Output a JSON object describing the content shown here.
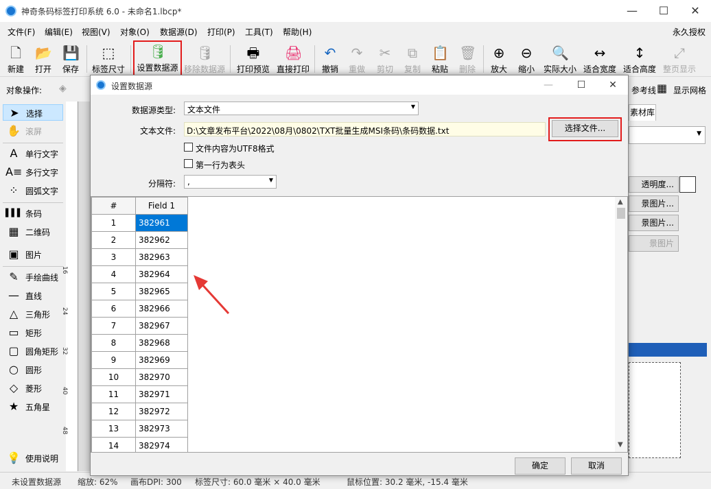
{
  "window": {
    "title": "神奇条码标签打印系统 6.0 - 未命名1.lbcp*",
    "min": "—",
    "max": "☐",
    "close": "✕"
  },
  "menu": {
    "items": [
      "文件(F)",
      "编辑(E)",
      "视图(V)",
      "对象(O)",
      "数据源(D)",
      "打印(P)",
      "工具(T)",
      "帮助(H)"
    ],
    "license": "永久授权"
  },
  "toolbar": [
    {
      "label": "新建",
      "icon": "new-file-icon",
      "glyph": "🗋"
    },
    {
      "label": "打开",
      "icon": "open-icon",
      "glyph": "📂"
    },
    {
      "label": "保存",
      "icon": "save-icon",
      "glyph": "💾"
    },
    {
      "label": "标签尺寸",
      "icon": "label-size-icon",
      "glyph": "⬚"
    },
    {
      "label": "设置数据源",
      "icon": "database-icon",
      "glyph": "🛢"
    },
    {
      "label": "移除数据源",
      "icon": "database-remove-icon",
      "glyph": "🛢"
    },
    {
      "label": "打印预览",
      "icon": "print-preview-icon",
      "glyph": "🖶"
    },
    {
      "label": "直接打印",
      "icon": "printer-icon",
      "glyph": "🖨"
    },
    {
      "label": "撤销",
      "icon": "undo-icon",
      "glyph": "↶"
    },
    {
      "label": "重做",
      "icon": "redo-icon",
      "glyph": "↷"
    },
    {
      "label": "剪切",
      "icon": "cut-icon",
      "glyph": "✂"
    },
    {
      "label": "复制",
      "icon": "copy-icon",
      "glyph": "⧉"
    },
    {
      "label": "粘贴",
      "icon": "paste-icon",
      "glyph": "📋"
    },
    {
      "label": "删除",
      "icon": "delete-icon",
      "glyph": "🗑"
    },
    {
      "label": "放大",
      "icon": "zoom-in-icon",
      "glyph": "⊕"
    },
    {
      "label": "缩小",
      "icon": "zoom-out-icon",
      "glyph": "⊖"
    },
    {
      "label": "实际大小",
      "icon": "actual-size-icon",
      "glyph": "🔍"
    },
    {
      "label": "适合宽度",
      "icon": "fit-width-icon",
      "glyph": "↔"
    },
    {
      "label": "适合高度",
      "icon": "fit-height-icon",
      "glyph": "↕"
    },
    {
      "label": "整页显示",
      "icon": "fit-page-icon",
      "glyph": "⤢"
    }
  ],
  "object_row": {
    "label": "对象操作:",
    "ref_line": "参考线",
    "show_grid": "显示网格"
  },
  "tools": [
    {
      "label": "选择",
      "icon": "pointer-icon",
      "glyph": "➤"
    },
    {
      "label": "滚屏",
      "icon": "hand-icon",
      "glyph": "✋"
    },
    {
      "label": "单行文字",
      "icon": "single-line-text-icon",
      "glyph": "A"
    },
    {
      "label": "多行文字",
      "icon": "multi-line-text-icon",
      "glyph": "A≡"
    },
    {
      "label": "圆弧文字",
      "icon": "arc-text-icon",
      "glyph": "⁘"
    },
    {
      "label": "条码",
      "icon": "barcode-icon",
      "glyph": "▌▌▌"
    },
    {
      "label": "二维码",
      "icon": "qrcode-icon",
      "glyph": "▦"
    },
    {
      "label": "图片",
      "icon": "image-icon",
      "glyph": "▣"
    },
    {
      "label": "手绘曲线",
      "icon": "pen-icon",
      "glyph": "✎"
    },
    {
      "label": "直线",
      "icon": "line-icon",
      "glyph": "—"
    },
    {
      "label": "三角形",
      "icon": "triangle-icon",
      "glyph": "△"
    },
    {
      "label": "矩形",
      "icon": "rectangle-icon",
      "glyph": "▭"
    },
    {
      "label": "圆角矩形",
      "icon": "rounded-rect-icon",
      "glyph": "▢"
    },
    {
      "label": "圆形",
      "icon": "circle-icon",
      "glyph": "○"
    },
    {
      "label": "菱形",
      "icon": "diamond-icon",
      "glyph": "◇"
    },
    {
      "label": "五角星",
      "icon": "star-icon",
      "glyph": "★"
    },
    {
      "label": "使用说明",
      "icon": "bulb-icon",
      "glyph": "💡"
    }
  ],
  "ruler_ticks": [
    "16",
    "24",
    "32",
    "40",
    "48"
  ],
  "right_panel": {
    "tab": "素材库",
    "b1": "透明度...",
    "b2": "景图片...",
    "b3": "景图片...",
    "b4": "景图片"
  },
  "status": {
    "s1": "未设置数据源",
    "s2": "缩放: 62%",
    "s3": "画布DPI: 300",
    "s4": "标签尺寸: 60.0 毫米 × 40.0 毫米",
    "s5": "鼠标位置: 30.2 毫米, -15.4 毫米"
  },
  "dialog": {
    "title": "设置数据源",
    "type_label": "数据源类型:",
    "type_value": "文本文件",
    "file_label": "文本文件:",
    "file_path": "D:\\文章发布平台\\2022\\08月\\0802\\TXT批量生成MSI条码\\条码数据.txt",
    "choose_btn": "选择文件...",
    "utf8": "文件内容为UTF8格式",
    "header_row": "第一行为表头",
    "sep_label": "分隔符:",
    "sep_value": ",",
    "col_hash": "#",
    "col_field1": "Field 1",
    "rows": [
      {
        "n": "1",
        "v": "382961"
      },
      {
        "n": "2",
        "v": "382962"
      },
      {
        "n": "3",
        "v": "382963"
      },
      {
        "n": "4",
        "v": "382964"
      },
      {
        "n": "5",
        "v": "382965"
      },
      {
        "n": "6",
        "v": "382966"
      },
      {
        "n": "7",
        "v": "382967"
      },
      {
        "n": "8",
        "v": "382968"
      },
      {
        "n": "9",
        "v": "382969"
      },
      {
        "n": "10",
        "v": "382970"
      },
      {
        "n": "11",
        "v": "382971"
      },
      {
        "n": "12",
        "v": "382972"
      },
      {
        "n": "13",
        "v": "382973"
      },
      {
        "n": "14",
        "v": "382974"
      }
    ],
    "ok": "确定",
    "cancel": "取消"
  }
}
